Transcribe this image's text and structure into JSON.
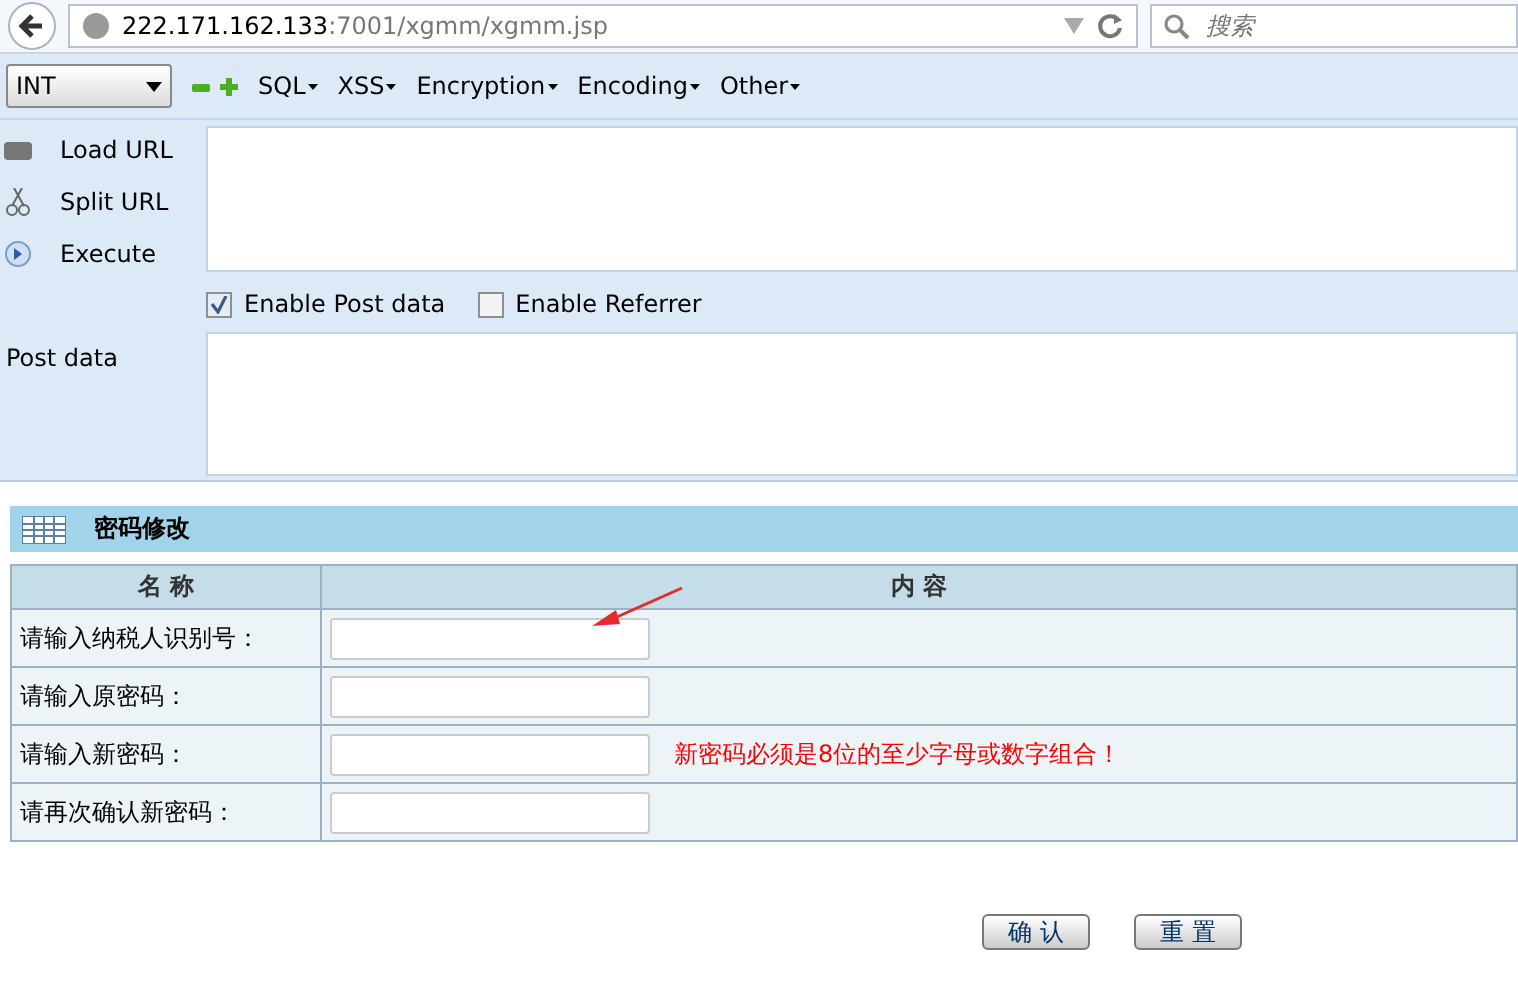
{
  "address_bar": {
    "host": "222.171.162.133",
    "path": ":7001/xgmm/xgmm.jsp"
  },
  "search": {
    "placeholder": "搜索"
  },
  "hackbar": {
    "select": "INT",
    "menus": [
      "SQL",
      "XSS",
      "Encryption",
      "Encoding",
      "Other"
    ],
    "actions": [
      "Load URL",
      "Split URL",
      "Execute"
    ],
    "options": [
      {
        "label": "Enable Post data",
        "checked": true
      },
      {
        "label": "Enable Referrer",
        "checked": false
      }
    ],
    "post_label": "Post data"
  },
  "form": {
    "title": "密码修改",
    "columns": [
      "名 称",
      "内 容"
    ],
    "rows": [
      {
        "label": "请输入纳税人识别号："
      },
      {
        "label": "请输入原密码："
      },
      {
        "label": "请输入新密码：",
        "hint": "新密码必须是8位的至少字母或数字组合！"
      },
      {
        "label": "请再次确认新密码："
      }
    ],
    "buttons": [
      "确 认",
      "重 置"
    ]
  }
}
